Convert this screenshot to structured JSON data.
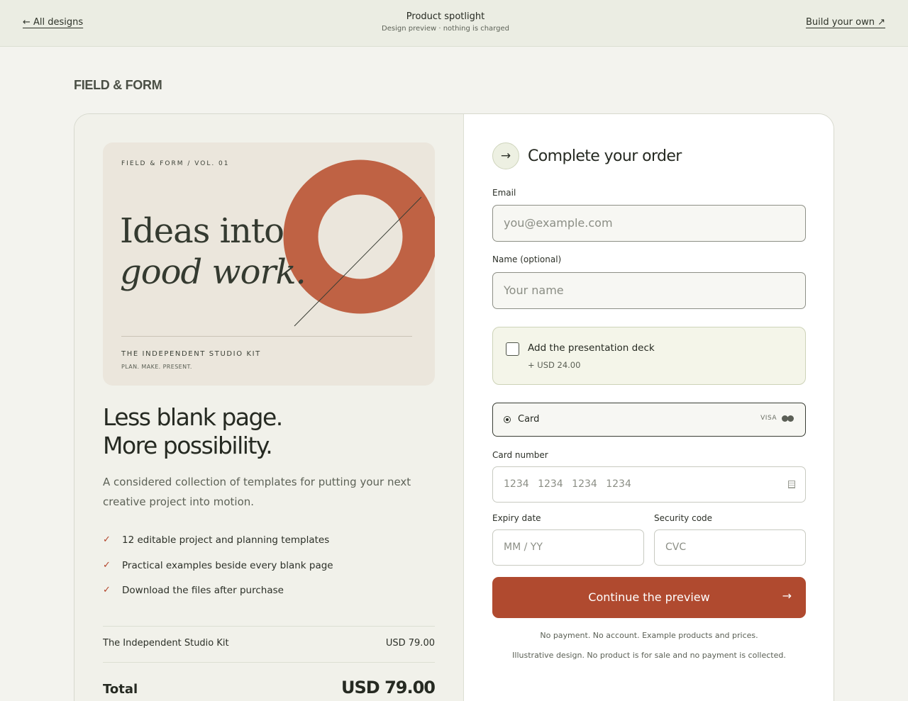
{
  "topbar": {
    "back_label": "← All designs",
    "title": "Product spotlight",
    "subtitle": "Design preview · nothing is charged",
    "build_label": "Build your own ↗"
  },
  "brand": "FIELD & FORM",
  "poster": {
    "kicker": "FIELD & FORM / VOL. 01",
    "headline_line1": "Ideas into",
    "headline_line2": "good work.",
    "kit_title": "THE INDEPENDENT STUDIO KIT",
    "kit_subtitle": "PLAN. MAKE. PRESENT.",
    "accent_color": "#bf6244"
  },
  "product": {
    "tagline_line1": "Less blank page.",
    "tagline_line2": "More possibility.",
    "description": "A considered collection of templates for putting your next creative project into motion.",
    "features": [
      "12 editable project and planning templates",
      "Practical examples beside every blank page",
      "Download the files after purchase"
    ],
    "line_item_name": "The Independent Studio Kit",
    "line_item_price": "USD 79.00",
    "total_label": "Total",
    "total_amount": "USD 79.00"
  },
  "form": {
    "title": "Complete your order",
    "email_label": "Email",
    "email_placeholder": "you@example.com",
    "name_label": "Name (optional)",
    "name_placeholder": "Your name",
    "addon_label": "Add the presentation deck",
    "addon_price": "+ USD 24.00",
    "addon_checked": false,
    "payment_option": "Card",
    "payment_brand": "VISA",
    "card_number_label": "Card number",
    "card_number_placeholder": "1234 1234 1234 1234",
    "expiry_label": "Expiry date",
    "expiry_placeholder": "MM / YY",
    "cvc_label": "Security code",
    "cvc_placeholder": "CVC",
    "submit_label": "Continue the preview",
    "note1": "No payment. No account. Example products and prices.",
    "note2": "Illustrative design. No product is for sale and no payment is collected.",
    "cta_color": "#b04a2f"
  }
}
